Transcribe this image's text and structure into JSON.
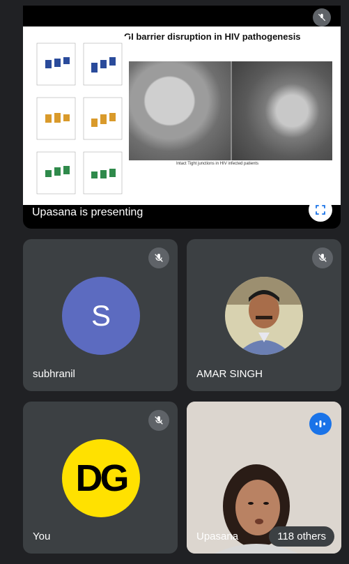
{
  "presentation": {
    "slide_title": "GI barrier disruption in HIV pathogenesis",
    "slide_caption": "Intact Tight junctions in HIV infected patients",
    "presenting_label": "Upasana is presenting",
    "fullscreen_icon": "fullscreen-icon"
  },
  "participants": [
    {
      "name": "subhranil",
      "avatar_letter": "S",
      "avatar_color": "#5c6bc0",
      "muted": true
    },
    {
      "name": "AMAR SINGH",
      "avatar_type": "photo",
      "muted": true
    },
    {
      "name": "You",
      "avatar_logo_text": "DG",
      "avatar_color": "#ffe100",
      "muted": true
    },
    {
      "name": "Upasana",
      "avatar_type": "video",
      "speaking": true
    }
  ],
  "others_chip": "118 others",
  "colors": {
    "background": "#202124",
    "tile": "#3c4043",
    "speaking_blue": "#1a73e8"
  }
}
